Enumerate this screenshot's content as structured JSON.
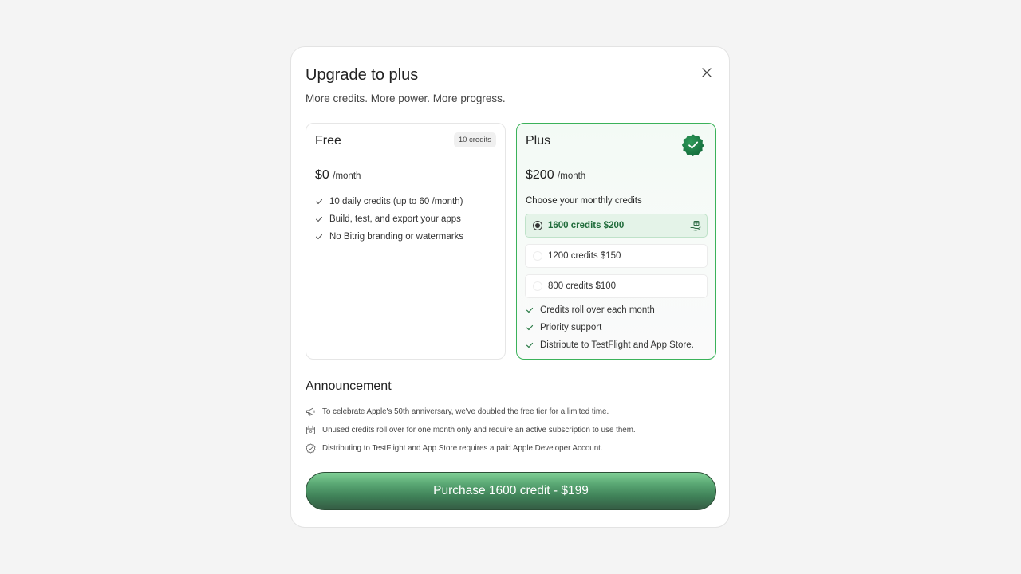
{
  "modal": {
    "title": "Upgrade to plus",
    "subtitle": "More credits. More power. More progress.",
    "close_icon": "close-icon"
  },
  "free": {
    "name": "Free",
    "badge": "10 credits",
    "price": "$0",
    "per": "/month",
    "features": [
      "10 daily credits (up to 60 /month)",
      "Build, test, and export your apps",
      "No Bitrig branding or watermarks"
    ]
  },
  "plus": {
    "name": "Plus",
    "selected_icon": "verified-seal-icon",
    "price": "$200",
    "per": "/month",
    "choose_label": "Choose your monthly credits",
    "options": [
      {
        "label": "1600 credits $200",
        "selected": true,
        "icon": "gift-hand-icon"
      },
      {
        "label": "1200 credits $150",
        "selected": false
      },
      {
        "label": "800 credits $100",
        "selected": false
      }
    ],
    "features": [
      "Credits roll over each month",
      "Priority support",
      "Distribute to TestFlight and App Store."
    ]
  },
  "announcement": {
    "title": "Announcement",
    "items": [
      {
        "icon": "megaphone-icon",
        "text": "To celebrate Apple's 50th anniversary, we've doubled the free tier for a limited time."
      },
      {
        "icon": "calendar-icon",
        "text": "Unused credits roll over for one month only and require an active subscription to use them."
      },
      {
        "icon": "badge-check-icon",
        "text": "Distributing to TestFlight and App Store requires a paid Apple Developer Account."
      }
    ]
  },
  "purchase_label": "Purchase 1600 credit - $199",
  "colors": {
    "accent": "#3bb25a",
    "button_dark": "#355c44",
    "selected_bg": "#e4f3e8",
    "selected_text": "#1f6b3a"
  }
}
